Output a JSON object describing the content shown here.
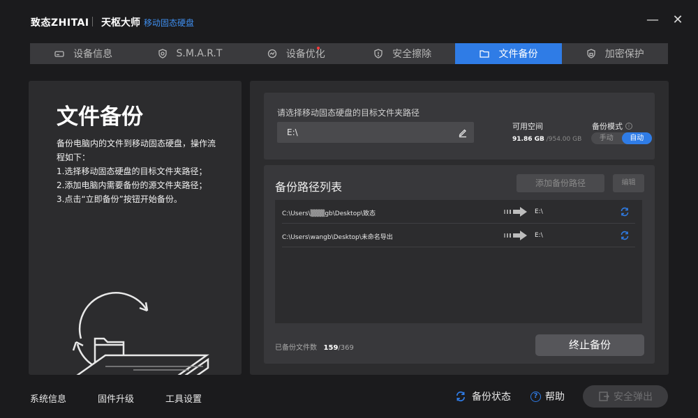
{
  "titlebar": {
    "brand": "致态ZHITAI",
    "product": "天枢大师",
    "subproduct": "移动固态硬盘",
    "minimize_label": "—",
    "close_label": "✕"
  },
  "tabs": [
    {
      "label": "设备信息",
      "icon": "drive-icon"
    },
    {
      "label": "S.M.A.R.T",
      "icon": "shield-icon"
    },
    {
      "label": "设备优化",
      "icon": "optimize-icon"
    },
    {
      "label": "安全擦除",
      "icon": "erase-shield-icon"
    },
    {
      "label": "文件备份",
      "icon": "folder-icon",
      "active": true
    },
    {
      "label": "加密保护",
      "icon": "lock-icon"
    }
  ],
  "left": {
    "title": "文件备份",
    "desc_intro": "备份电脑内的文件到移动固态硬盘，操作流程如下：",
    "steps": [
      "1.选择移动固态硬盘的目标文件夹路径；",
      "2.添加电脑内需要备份的源文件夹路径；",
      "3.点击“立即备份”按钮开始备份。"
    ]
  },
  "target": {
    "label": "请选择移动固态硬盘的目标文件夹路径",
    "path_value": "E:\\",
    "space_label": "可用空间",
    "free": "91.86 GB",
    "total": " /954.00 GB",
    "mode_label": "备份模式",
    "mode_manual": "手动",
    "mode_auto": "自动"
  },
  "list": {
    "title": "备份路径列表",
    "add_button": "添加备份路径",
    "edit_button": "编辑",
    "rows": [
      {
        "src": "C:\\Users\\▒▒▒gb\\Desktop\\致态",
        "dst": "E:\\"
      },
      {
        "src": "C:\\Users\\wangb\\Desktop\\未命名导出",
        "dst": "E:\\"
      }
    ],
    "count_label": "已备份文件数",
    "count_done": "159",
    "count_total": "/369",
    "stop_button": "终止备份"
  },
  "bottom": {
    "system_info": "系统信息",
    "firmware": "固件升级",
    "tools": "工具设置",
    "backup_status": "备份状态",
    "help": "帮助",
    "eject": "安全弹出"
  },
  "colors": {
    "accent": "#2f7ce6",
    "background": "#1b1b1d",
    "panel": "#2c2c2e"
  }
}
